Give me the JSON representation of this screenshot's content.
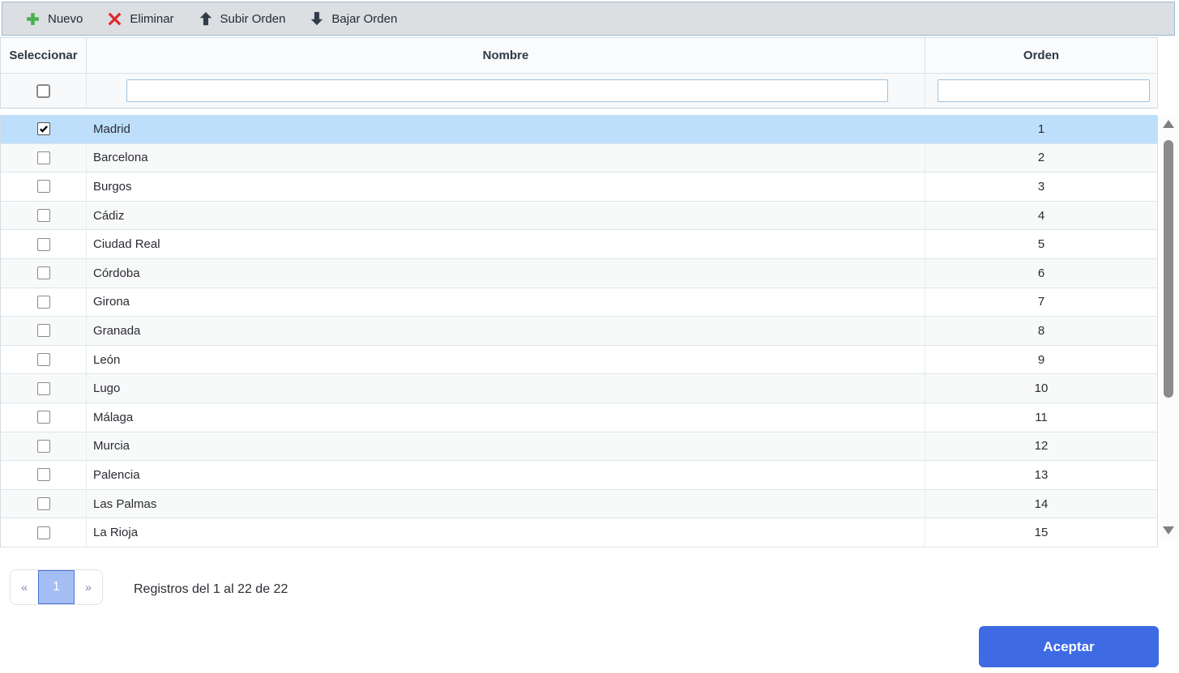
{
  "toolbar": {
    "buttons": [
      {
        "label": "Nuevo",
        "icon": "plus-icon"
      },
      {
        "label": "Eliminar",
        "icon": "x-icon"
      },
      {
        "label": "Subir Orden",
        "icon": "arrow-up-icon"
      },
      {
        "label": "Bajar Orden",
        "icon": "arrow-down-icon"
      }
    ]
  },
  "table": {
    "columns": [
      {
        "key": "seleccionar",
        "label": "Seleccionar"
      },
      {
        "key": "nombre",
        "label": "Nombre"
      },
      {
        "key": "orden",
        "label": "Orden"
      }
    ],
    "filters": {
      "nombre": "",
      "orden": "",
      "header_checkbox_checked": false
    },
    "rows": [
      {
        "nombre": "Madrid",
        "orden": "1",
        "checked": true,
        "selected": true
      },
      {
        "nombre": "Barcelona",
        "orden": "2",
        "checked": false,
        "selected": false
      },
      {
        "nombre": "Burgos",
        "orden": "3",
        "checked": false,
        "selected": false
      },
      {
        "nombre": "Cádiz",
        "orden": "4",
        "checked": false,
        "selected": false
      },
      {
        "nombre": "Ciudad Real",
        "orden": "5",
        "checked": false,
        "selected": false
      },
      {
        "nombre": "Córdoba",
        "orden": "6",
        "checked": false,
        "selected": false
      },
      {
        "nombre": "Girona",
        "orden": "7",
        "checked": false,
        "selected": false
      },
      {
        "nombre": "Granada",
        "orden": "8",
        "checked": false,
        "selected": false
      },
      {
        "nombre": "León",
        "orden": "9",
        "checked": false,
        "selected": false
      },
      {
        "nombre": "Lugo",
        "orden": "10",
        "checked": false,
        "selected": false
      },
      {
        "nombre": "Málaga",
        "orden": "11",
        "checked": false,
        "selected": false
      },
      {
        "nombre": "Murcia",
        "orden": "12",
        "checked": false,
        "selected": false
      },
      {
        "nombre": "Palencia",
        "orden": "13",
        "checked": false,
        "selected": false
      },
      {
        "nombre": "Las Palmas",
        "orden": "14",
        "checked": false,
        "selected": false
      },
      {
        "nombre": "La Rioja",
        "orden": "15",
        "checked": false,
        "selected": false
      }
    ]
  },
  "pagination": {
    "prev": "«",
    "current_page": "1",
    "next": "»",
    "summary": "Registros del 1 al 22 de 22"
  },
  "footer": {
    "accept_label": "Aceptar"
  },
  "colors": {
    "accent_blue": "#3e6be4",
    "selected_row": "#bddffb",
    "toolbar_bg": "#dbdfe1",
    "toolbar_border": "#9db8ce",
    "plus_green": "#4caf50",
    "delete_red": "#dd2a2a",
    "arrow_dark": "#333c4a",
    "pager_active_bg": "#a4bdf2",
    "pager_active_border": "#4a73db"
  }
}
